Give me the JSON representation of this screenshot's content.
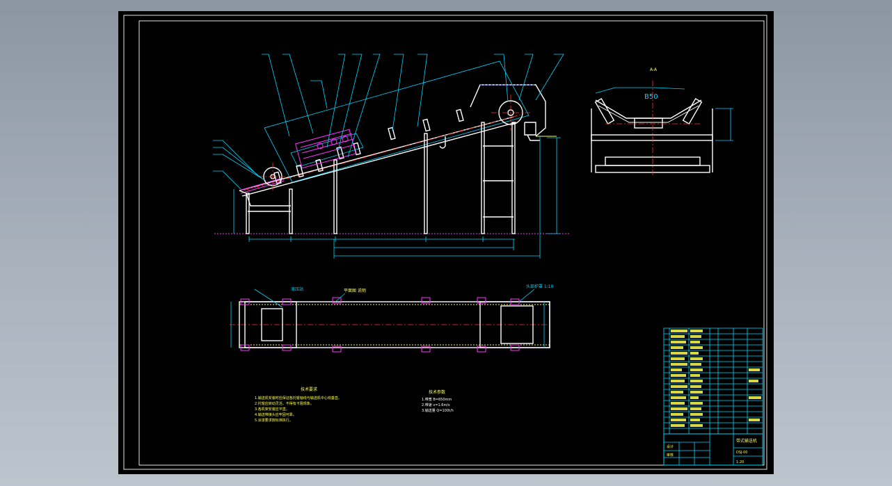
{
  "drawing_labels": {
    "top_view_note": "平面图 说明",
    "left_tag": "液压站",
    "cross_section_width": "B50",
    "section_mark": "A-A",
    "right_tag": "头部护罩 1:10",
    "tech_req_title": "技术要求",
    "tech_req_lines": [
      "1.输送机安装时应保证各托辊轴线与输送机中心线垂直。",
      "2.托辊应转动灵活，不得有卡阻现象。",
      "3.各机架安装应平直。",
      "4.输送带接头应牢固可靠。",
      "5.涂漆要求按标准执行。"
    ],
    "spec_title": "技术参数",
    "spec_lines": [
      "1.带宽 B=650mm",
      "2.带速 v=1.6m/s",
      "3.输送量 Q=100t/h"
    ]
  },
  "title_block": {
    "drawing_name": "带式输送机",
    "drawing_number": "DSJ-00",
    "scale": "1:20",
    "designer_label": "设计",
    "checker_label": "审核"
  },
  "colors": {
    "background": "#000000",
    "frame": "#ffffff",
    "dimension": "#00d8ff",
    "belt_parts": "#ff33ff",
    "centerline": "#ff3333"
  }
}
